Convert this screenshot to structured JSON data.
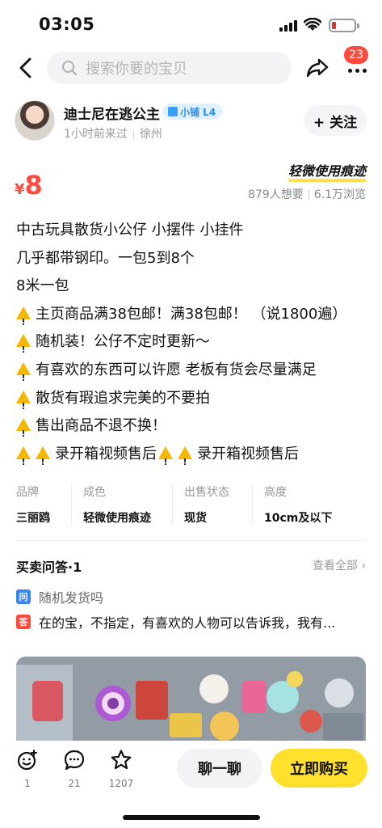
{
  "status_bar": {
    "time": "03:05"
  },
  "nav": {
    "search_placeholder": "搜索你要的宝贝",
    "message_badge": "23"
  },
  "seller": {
    "name": "迪士尼在逃公主",
    "level_tag": "小铺 L4",
    "last_seen": "1小时前来过",
    "location": "徐州",
    "follow_label": "+ 关注"
  },
  "price": {
    "symbol": "¥",
    "value": "8",
    "condition": "轻微使用痕迹",
    "wants": "879人想要",
    "views": "6.1万浏览"
  },
  "description": {
    "lines": [
      "中古玩具散货小公仔 小摆件 小挂件",
      "几乎都带钢印。一包5到8个",
      "8米一包",
      "主页商品满38包邮！满38包邮！ （说1800遍）",
      "随机装！公仔不定时更新～",
      "有喜欢的东西可以许愿 老板有货会尽量满足",
      "散货有瑕追求完美的不要拍",
      "售出商品不退不换！",
      "录开箱视频售后",
      "录开箱视频售后"
    ]
  },
  "attributes": [
    {
      "key": "品牌",
      "value": "三丽鸥"
    },
    {
      "key": "成色",
      "value": "轻微使用痕迹"
    },
    {
      "key": "出售状态",
      "value": "现货"
    },
    {
      "key": "高度",
      "value": "10cm及以下"
    }
  ],
  "qa": {
    "title": "买卖问答·1",
    "view_all": "查看全部",
    "question_tag": "问",
    "question": "随机发货吗",
    "answer_tag": "答",
    "answer": "在的宝，不指定，有喜欢的人物可以告诉我，我有..."
  },
  "bottom_bar": {
    "likes": "1",
    "comments": "21",
    "favorites": "1207",
    "chat_label": "聊一聊",
    "buy_label": "立即购买"
  },
  "colors": {
    "price_red": "#ff4a3d",
    "buy_yellow": "#ffe12d",
    "level_blue": "#2b8de0"
  }
}
